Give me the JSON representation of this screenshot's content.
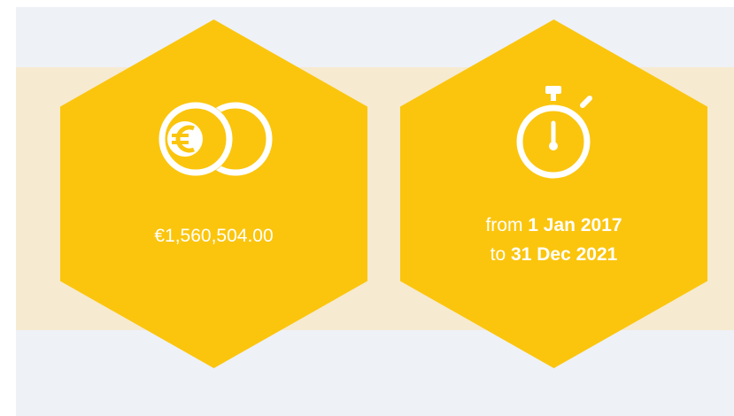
{
  "colors": {
    "background": "#eef1f6",
    "band": "#f6ead0",
    "hexagon": "#fbc50d",
    "text": "#ffffff"
  },
  "funding": {
    "icon": "euro-coins-icon",
    "amount": "€1,560,504.00"
  },
  "duration": {
    "icon": "stopwatch-icon",
    "from_label": "from",
    "start_date": "1 Jan 2017",
    "to_label": "to",
    "end_date": "31 Dec 2021"
  }
}
